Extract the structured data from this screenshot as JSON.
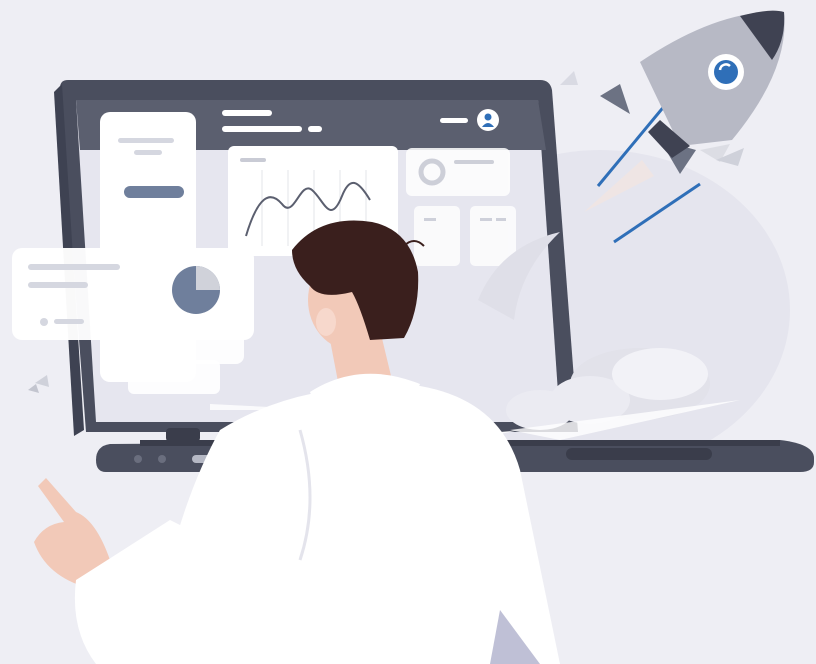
{
  "scene": {
    "description_free": true,
    "colors": {
      "background": "#eeeef4",
      "laptop_frame": "#4a4e5e",
      "screen_header": "#5b5f6f",
      "screen_body": "#e6e6ef",
      "card": "#ffffff",
      "accent_blue": "#2f6fb8",
      "slate": "#6f7f9c",
      "hair": "#3a1f1d",
      "skin": "#f2c9b8",
      "shirt": "#ffffff",
      "rocket_body": "#b7b9c5",
      "rocket_nose": "#3f4252"
    },
    "icons": {
      "avatar": "user-avatar-icon",
      "rocket": "rocket-icon",
      "pie": "pie-chart-icon",
      "donut": "donut-chart-icon",
      "line": "line-chart-icon"
    },
    "pie_chart": {
      "highlighted_fraction": 0.25
    }
  }
}
